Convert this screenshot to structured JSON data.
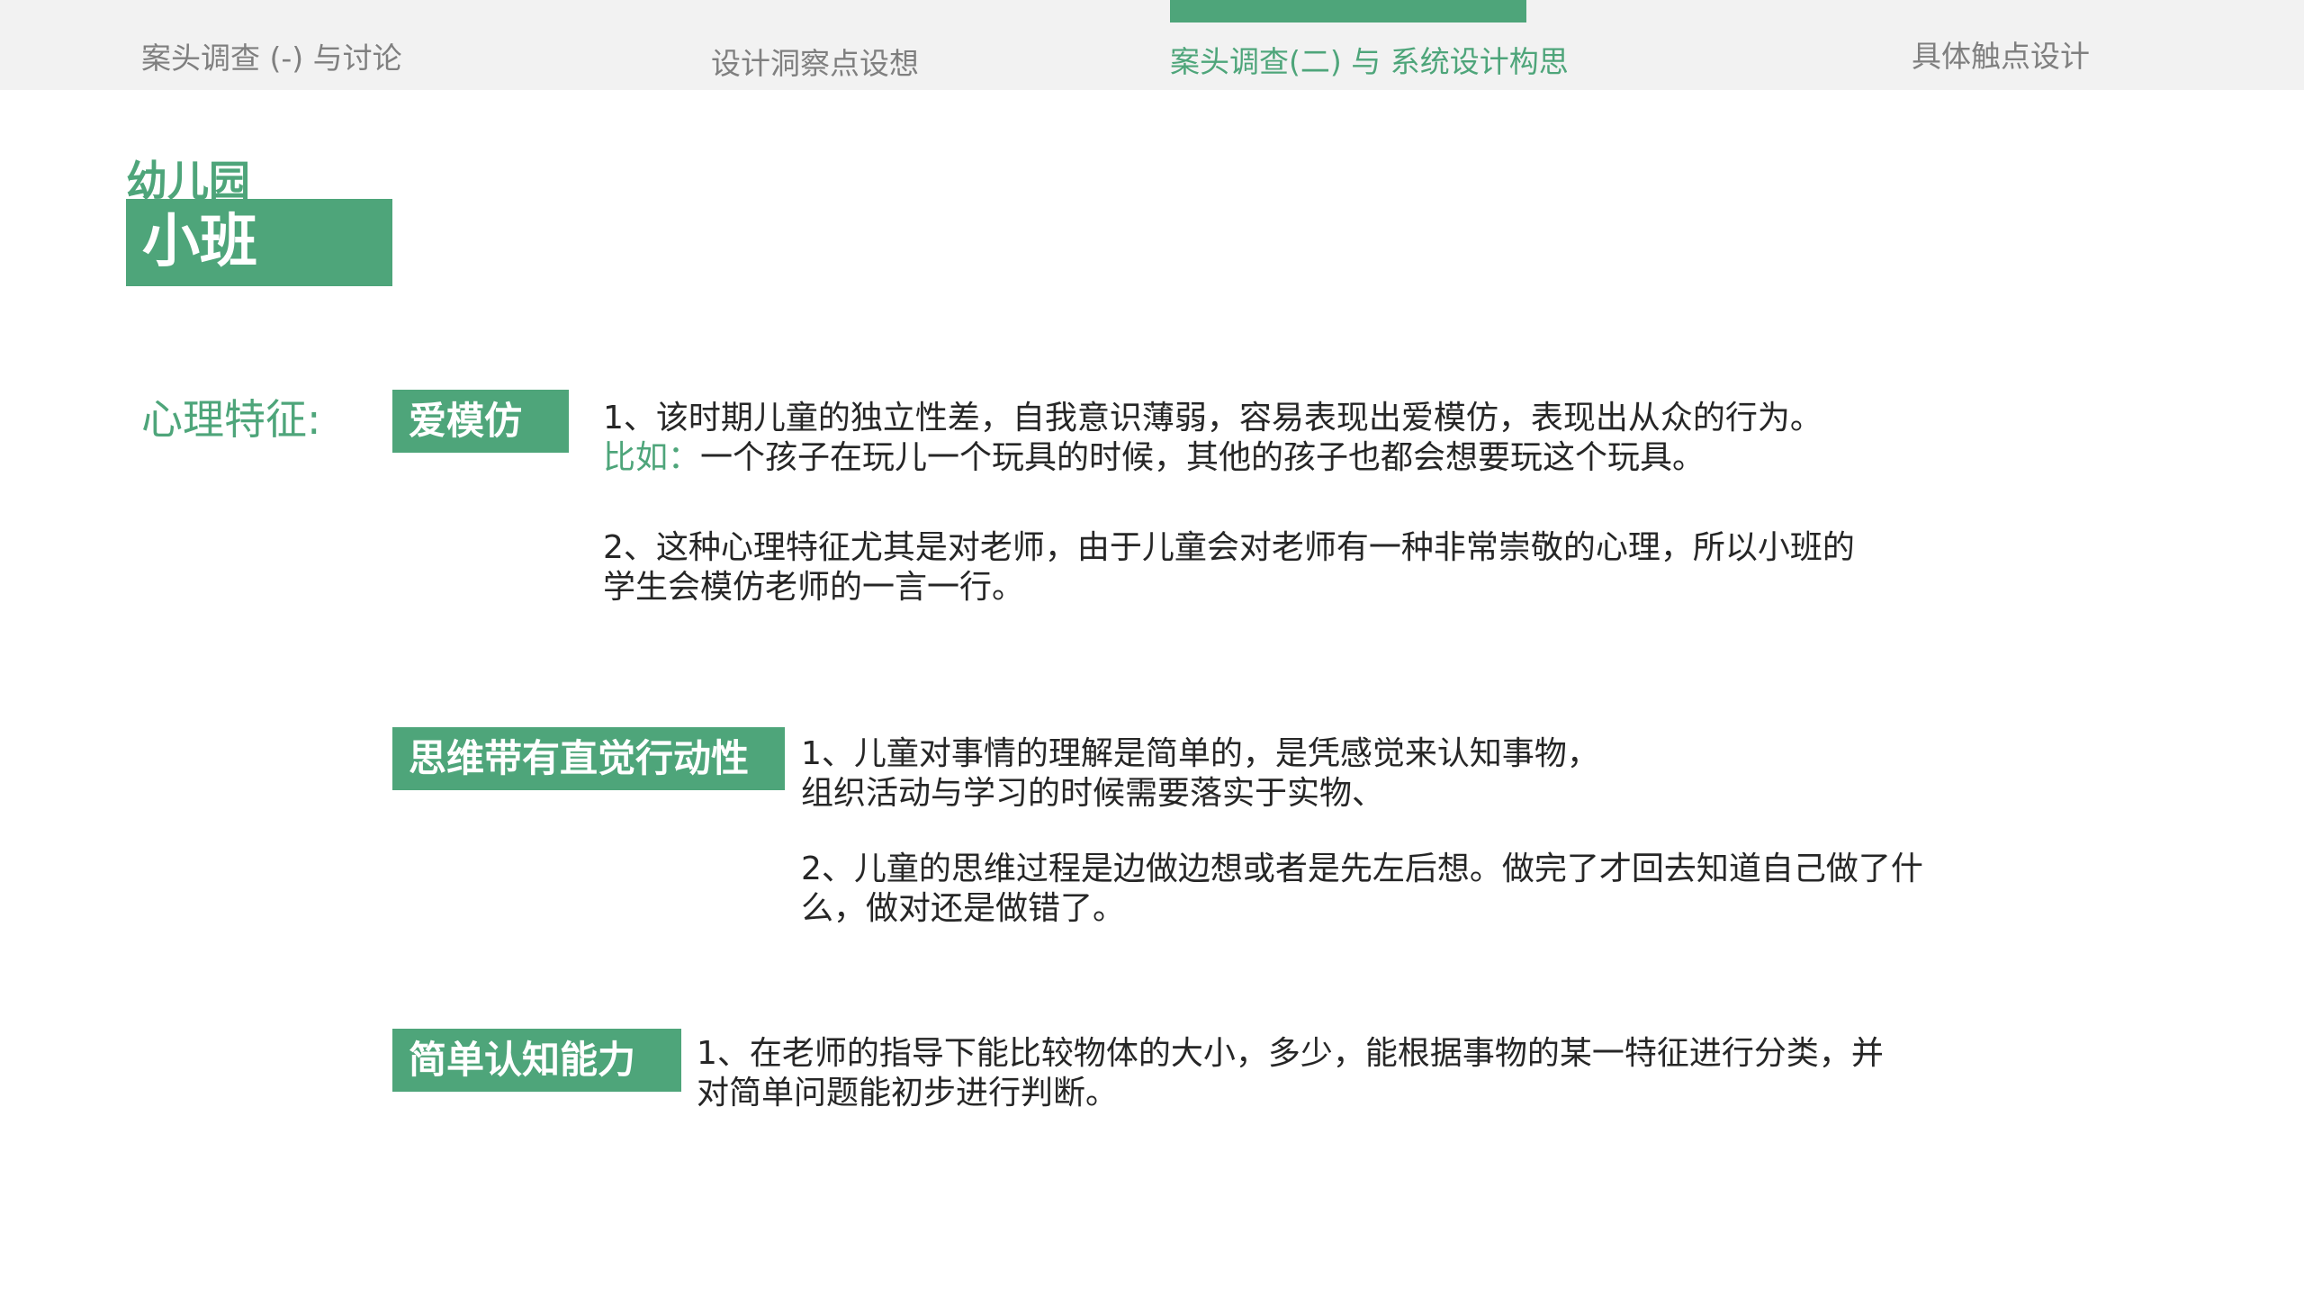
{
  "nav": {
    "tabs": [
      {
        "label": "案头调查 (-) 与讨论"
      },
      {
        "label": "设计洞察点设想"
      },
      {
        "label": "案头调查(二) 与 系统设计构思"
      },
      {
        "label": "具体触点设计"
      }
    ],
    "active_index": 2
  },
  "header": {
    "kicker": "幼儿园",
    "title": "小班"
  },
  "section": {
    "label": "心理特征:"
  },
  "features": [
    {
      "tag": "爱模仿",
      "paragraphs": [
        {
          "line1": "1、该时期儿童的独立性差，自我意识薄弱，容易表现出爱模仿，表现出从众的行为。",
          "line2_prefix": "比如：",
          "line2": "一个孩子在玩儿一个玩具的时候，其他的孩子也都会想要玩这个玩具。"
        },
        {
          "line1": "2、这种心理特征尤其是对老师，由于儿童会对老师有一种非常崇敬的心理，所以小班的",
          "line2": "学生会模仿老师的一言一行。"
        }
      ]
    },
    {
      "tag": "思维带有直觉行动性",
      "paragraphs": [
        {
          "line1": "1、儿童对事情的理解是简单的，是凭感觉来认知事物，",
          "line2": "组织活动与学习的时候需要落实于实物、"
        },
        {
          "line1": "2、儿童的思维过程是边做边想或者是先左后想。做完了才回去知道自己做了什",
          "line2": "么，做对还是做错了。"
        }
      ]
    },
    {
      "tag": "简单认知能力",
      "paragraphs": [
        {
          "line1": "1、在老师的指导下能比较物体的大小，多少，能根据事物的某一特征进行分类，并",
          "line2": "对简单问题能初步进行判断。"
        }
      ]
    }
  ],
  "colors": {
    "accent": "#4ea57a",
    "nav_bg": "#f2f2f2",
    "nav_text": "#7f7f7f",
    "body_text": "#262626"
  }
}
